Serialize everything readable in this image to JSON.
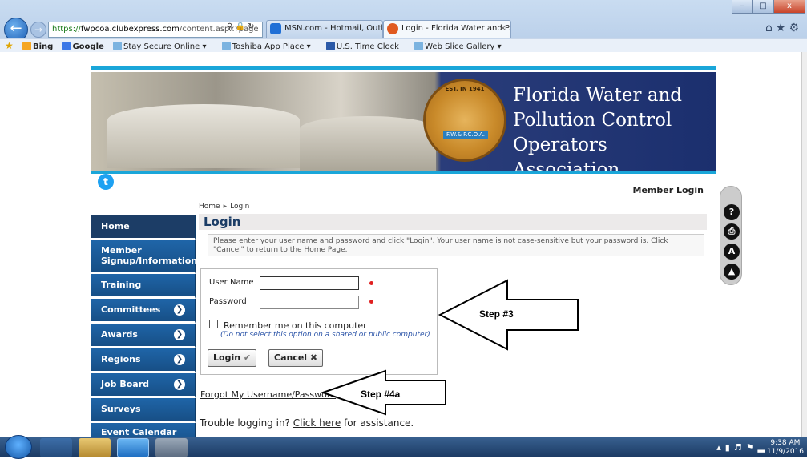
{
  "browser": {
    "address": {
      "https": "https://",
      "domain": "fwpcoa.clubexpress.com",
      "path": "/content.aspx?page"
    },
    "tabs": [
      {
        "label": "MSN.com - Hotmail, Outlook, ..."
      },
      {
        "label": "Login - Florida Water and P...",
        "close": "×"
      }
    ],
    "favorites": [
      "Bing",
      "Google",
      "Stay Secure Online ▾",
      "Toshiba App Place ▾",
      "U.S. Time Clock",
      "Web Slice Gallery ▾"
    ],
    "window_buttons": [
      "–",
      "□",
      "x"
    ]
  },
  "banner": {
    "established": "EST. IN 1941",
    "abbr": "F.W.& P.C.O.A.",
    "org_name": "Florida Water and Pollution Control Operators Association"
  },
  "header": {
    "member_login": "Member Login"
  },
  "breadcrumb": {
    "home": "Home",
    "separator": "▸",
    "current": "Login"
  },
  "sidebar": {
    "items": [
      {
        "label": "Home",
        "has_arrow": false
      },
      {
        "label": "Member Signup/Information",
        "has_arrow": false
      },
      {
        "label": "Training",
        "has_arrow": false
      },
      {
        "label": "Committees",
        "has_arrow": true
      },
      {
        "label": "Awards",
        "has_arrow": true
      },
      {
        "label": "Regions",
        "has_arrow": true
      },
      {
        "label": "Job Board",
        "has_arrow": true
      },
      {
        "label": "Surveys",
        "has_arrow": false
      },
      {
        "label": "Event Calendar",
        "has_arrow": false
      }
    ]
  },
  "login": {
    "title": "Login",
    "instructions": "Please enter your user name and password and click \"Login\". Your user name is not case-sensitive but your password is. Click \"Cancel\" to return to the Home Page.",
    "username_label": "User Name",
    "username_value": "",
    "password_label": "Password",
    "password_value": "",
    "remember_label": "Remember me on this computer",
    "remember_checked": false,
    "remember_note": "(Do not select this option on a shared or public computer)",
    "login_button": "Login",
    "cancel_button": "Cancel",
    "forgot_link": "Forgot My Username/Password",
    "trouble_prefix": "Trouble logging in? ",
    "trouble_link": "Click here",
    "trouble_suffix": " for assistance."
  },
  "annotations": {
    "step3": "Step #3",
    "step4a": "Step #4a"
  },
  "tools": [
    "?",
    "⎙",
    "A",
    "▲"
  ],
  "taskbar": {
    "time": "9:38 AM",
    "date": "11/9/2016"
  }
}
